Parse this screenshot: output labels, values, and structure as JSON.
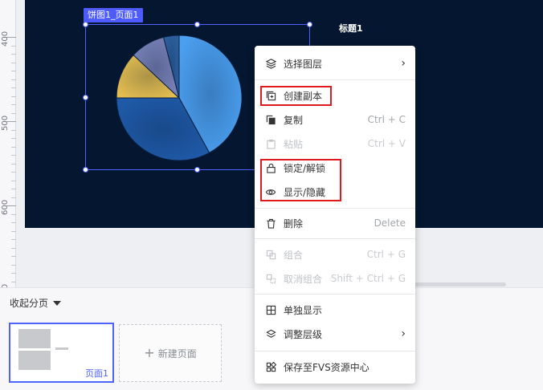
{
  "ruler": {
    "labels": [
      "400",
      "500",
      "600",
      "700",
      "800"
    ]
  },
  "canvas": {
    "title_text": "标题1",
    "selected_label": "饼图1_页面1"
  },
  "chart_data": {
    "type": "pie",
    "values": [
      42,
      33,
      12,
      9,
      4
    ],
    "colors": [
      "#4b9ff0",
      "#1f5aa8",
      "#e3bd4f",
      "#7a82b8",
      "#2d5f9e"
    ]
  },
  "pages": {
    "collapse_label": "收起分页",
    "thumb_label": "页面1",
    "new_page_label": "新建页面"
  },
  "context_menu": {
    "items": [
      {
        "label": "选择图层",
        "icon": "layers-icon",
        "has_submenu": true
      },
      {
        "label": "创建副本",
        "icon": "duplicate-icon"
      },
      {
        "label": "复制",
        "icon": "copy-icon",
        "shortcut": "Ctrl + C"
      },
      {
        "label": "粘贴",
        "icon": "paste-icon",
        "shortcut": "Ctrl + V",
        "disabled": true
      },
      {
        "label": "锁定/解锁",
        "icon": "lock-icon"
      },
      {
        "label": "显示/隐藏",
        "icon": "eye-icon"
      },
      {
        "label": "删除",
        "icon": "trash-icon",
        "shortcut": "Delete"
      },
      {
        "label": "组合",
        "icon": "group-icon",
        "shortcut": "Ctrl + G",
        "disabled": true
      },
      {
        "label": "取消组合",
        "icon": "ungroup-icon",
        "shortcut": "Shift + Ctrl + G",
        "disabled": true
      },
      {
        "label": "单独显示",
        "icon": "solo-icon"
      },
      {
        "label": "调整层级",
        "icon": "layer-order-icon",
        "has_submenu": true
      },
      {
        "label": "保存至FVS资源中心",
        "icon": "save-resource-icon"
      }
    ],
    "highlight_color": "#e0191f"
  }
}
